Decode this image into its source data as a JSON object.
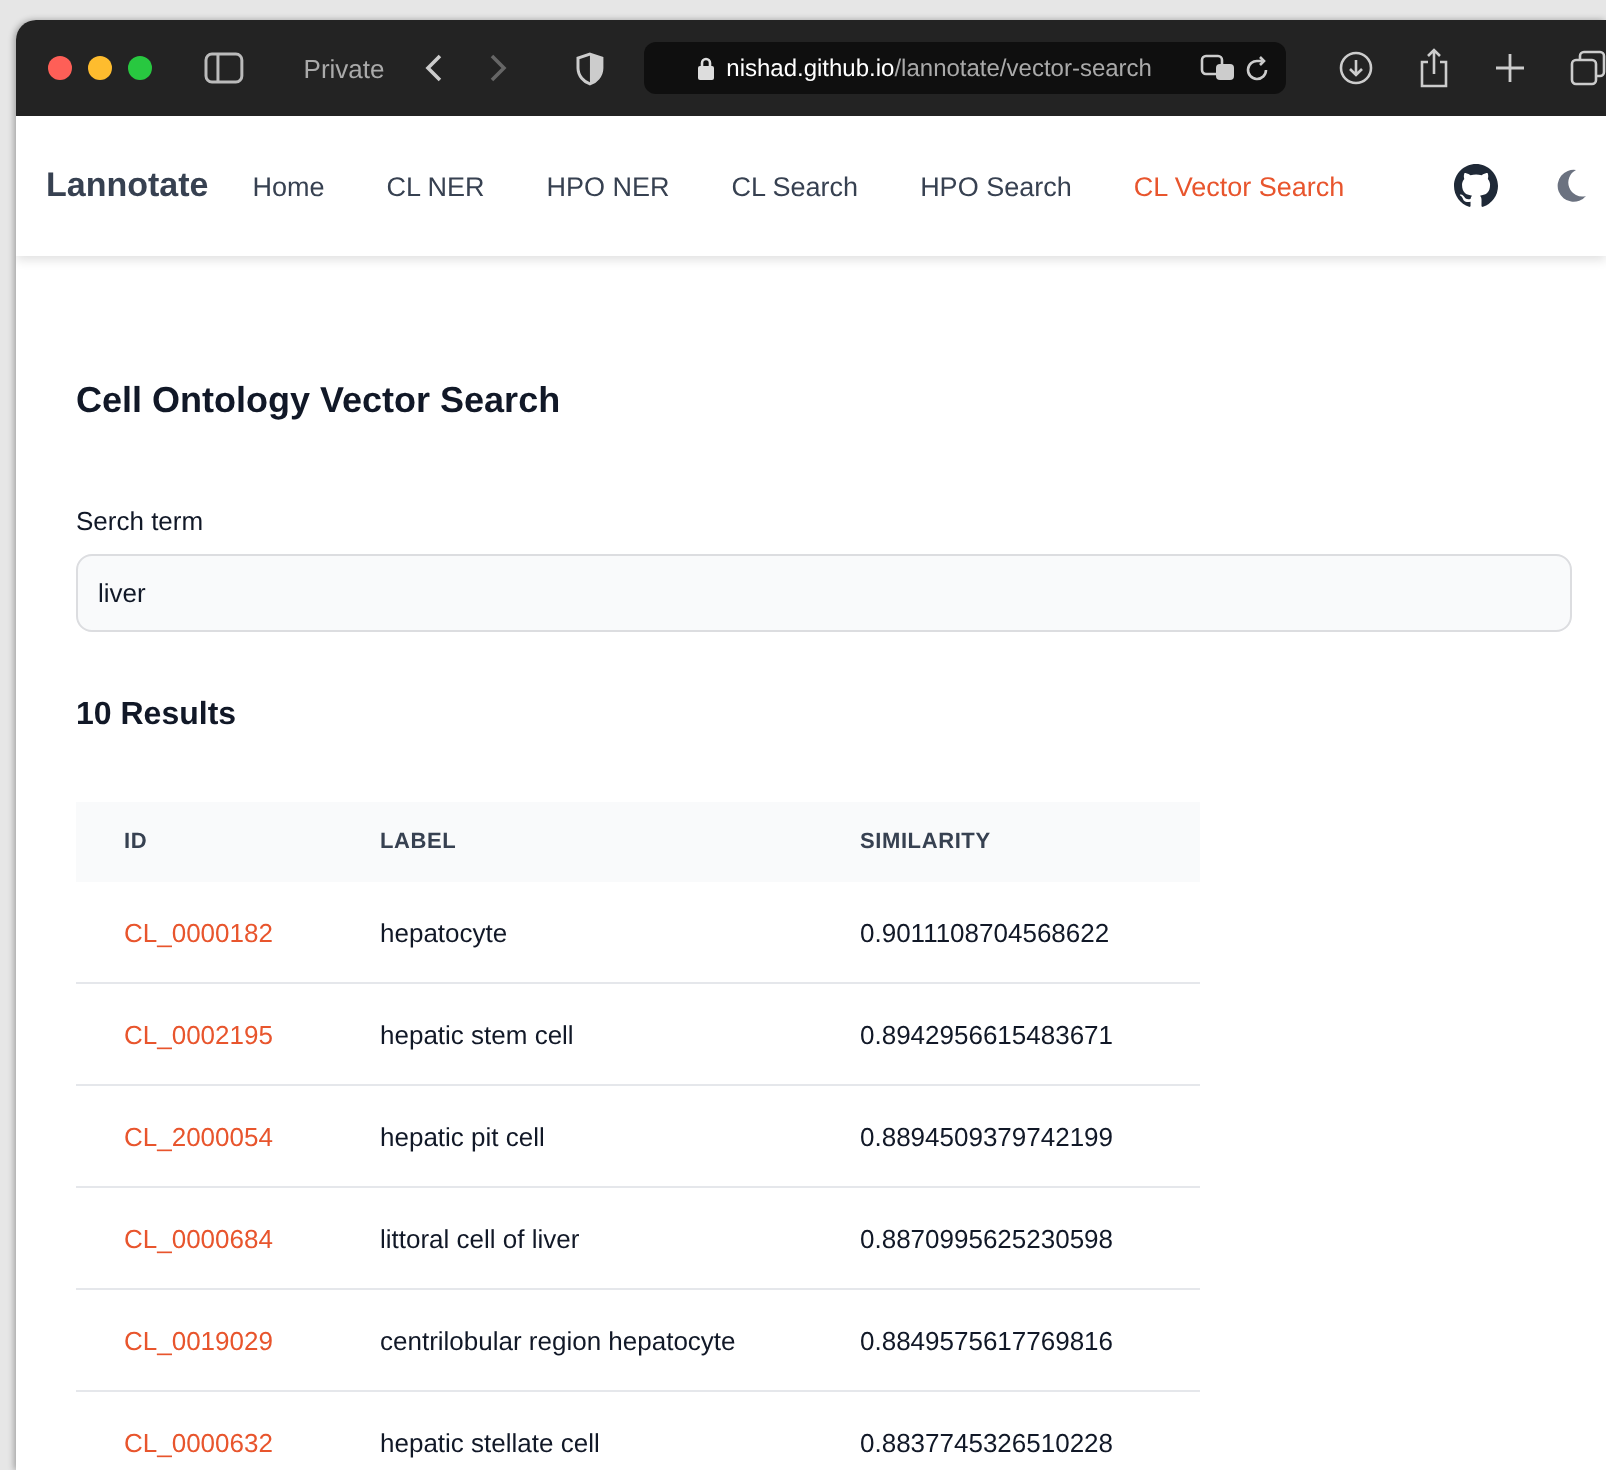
{
  "browser": {
    "private_label": "Private",
    "url_host": "nishad.github.io",
    "url_path": "/lannotate/vector-search"
  },
  "nav": {
    "brand": "Lannotate",
    "links": [
      {
        "label": "Home",
        "selected": false
      },
      {
        "label": "CL NER",
        "selected": false
      },
      {
        "label": "HPO NER",
        "selected": false
      },
      {
        "label": "CL Search",
        "selected": false
      },
      {
        "label": "HPO Search",
        "selected": false
      },
      {
        "label": "CL Vector Search",
        "selected": true
      }
    ]
  },
  "page": {
    "title": "Cell Ontology Vector Search",
    "search": {
      "label": "Serch term",
      "value": "liver"
    },
    "results_heading": "10 Results"
  },
  "table": {
    "columns": [
      "ID",
      "LABEL",
      "SIMILARITY"
    ],
    "rows": [
      [
        "CL_0000182",
        "hepatocyte",
        "0.9011108704568622"
      ],
      [
        "CL_0002195",
        "hepatic stem cell",
        "0.8942956615483671"
      ],
      [
        "CL_2000054",
        "hepatic pit cell",
        "0.8894509379742199"
      ],
      [
        "CL_0000684",
        "littoral cell of liver",
        "0.8870995625230598"
      ],
      [
        "CL_0019029",
        "centrilobular region hepatocyte",
        "0.8849575617769816"
      ],
      [
        "CL_0000632",
        "hepatic stellate cell",
        "0.8837745326510228"
      ]
    ]
  }
}
